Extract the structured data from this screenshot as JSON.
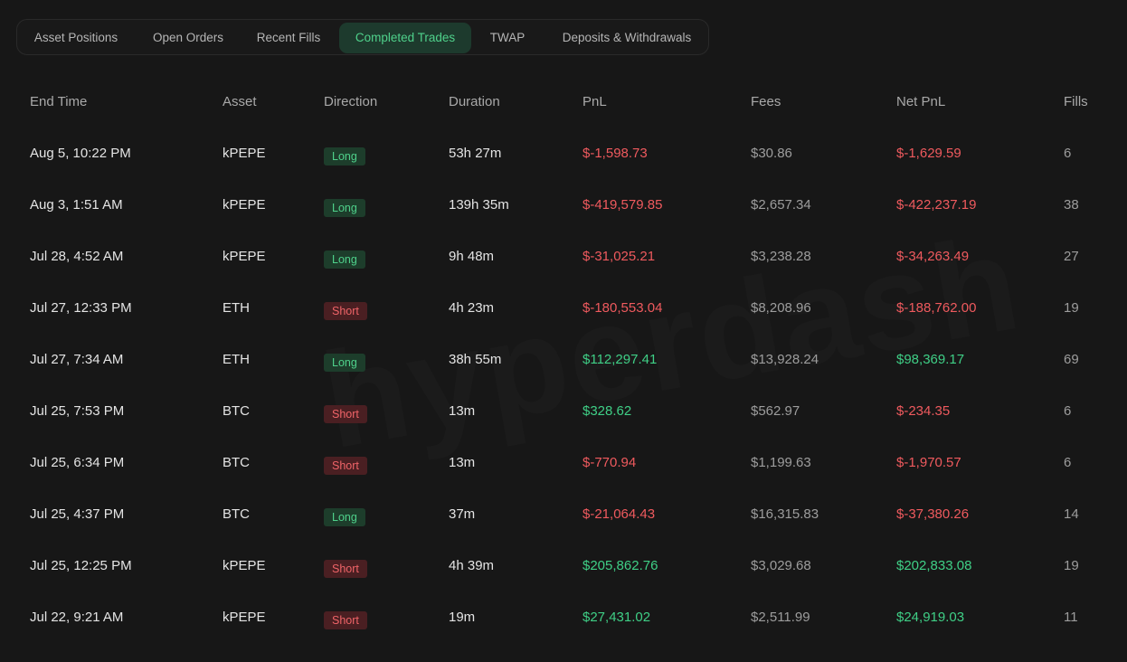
{
  "tabs": [
    {
      "label": "Asset Positions",
      "active": false
    },
    {
      "label": "Open Orders",
      "active": false
    },
    {
      "label": "Recent Fills",
      "active": false
    },
    {
      "label": "Completed Trades",
      "active": true
    },
    {
      "label": "TWAP",
      "active": false
    },
    {
      "label": "Deposits & Withdrawals",
      "active": false
    }
  ],
  "watermark": "hyperdash",
  "table": {
    "columns": [
      "End Time",
      "Asset",
      "Direction",
      "Duration",
      "PnL",
      "Fees",
      "Net PnL",
      "Fills"
    ],
    "rows": [
      {
        "end_time": "Aug 5, 10:22 PM",
        "asset": "kPEPE",
        "direction": "Long",
        "duration": "53h 27m",
        "pnl": "$-1,598.73",
        "fees": "$30.86",
        "net_pnl": "$-1,629.59",
        "fills": "6"
      },
      {
        "end_time": "Aug 3, 1:51 AM",
        "asset": "kPEPE",
        "direction": "Long",
        "duration": "139h 35m",
        "pnl": "$-419,579.85",
        "fees": "$2,657.34",
        "net_pnl": "$-422,237.19",
        "fills": "38"
      },
      {
        "end_time": "Jul 28, 4:52 AM",
        "asset": "kPEPE",
        "direction": "Long",
        "duration": "9h 48m",
        "pnl": "$-31,025.21",
        "fees": "$3,238.28",
        "net_pnl": "$-34,263.49",
        "fills": "27"
      },
      {
        "end_time": "Jul 27, 12:33 PM",
        "asset": "ETH",
        "direction": "Short",
        "duration": "4h 23m",
        "pnl": "$-180,553.04",
        "fees": "$8,208.96",
        "net_pnl": "$-188,762.00",
        "fills": "19"
      },
      {
        "end_time": "Jul 27, 7:34 AM",
        "asset": "ETH",
        "direction": "Long",
        "duration": "38h 55m",
        "pnl": "$112,297.41",
        "fees": "$13,928.24",
        "net_pnl": "$98,369.17",
        "fills": "69"
      },
      {
        "end_time": "Jul 25, 7:53 PM",
        "asset": "BTC",
        "direction": "Short",
        "duration": "13m",
        "pnl": "$328.62",
        "fees": "$562.97",
        "net_pnl": "$-234.35",
        "fills": "6"
      },
      {
        "end_time": "Jul 25, 6:34 PM",
        "asset": "BTC",
        "direction": "Short",
        "duration": "13m",
        "pnl": "$-770.94",
        "fees": "$1,199.63",
        "net_pnl": "$-1,970.57",
        "fills": "6"
      },
      {
        "end_time": "Jul 25, 4:37 PM",
        "asset": "BTC",
        "direction": "Long",
        "duration": "37m",
        "pnl": "$-21,064.43",
        "fees": "$16,315.83",
        "net_pnl": "$-37,380.26",
        "fills": "14"
      },
      {
        "end_time": "Jul 25, 12:25 PM",
        "asset": "kPEPE",
        "direction": "Short",
        "duration": "4h 39m",
        "pnl": "$205,862.76",
        "fees": "$3,029.68",
        "net_pnl": "$202,833.08",
        "fills": "19"
      },
      {
        "end_time": "Jul 22, 9:21 AM",
        "asset": "kPEPE",
        "direction": "Short",
        "duration": "19m",
        "pnl": "$27,431.02",
        "fees": "$2,511.99",
        "net_pnl": "$24,919.03",
        "fills": "11"
      }
    ]
  },
  "colors": {
    "background": "#171717",
    "positive": "#3fcf86",
    "negative": "#ef5a5e",
    "active_tab_bg": "#1d3a2d"
  }
}
